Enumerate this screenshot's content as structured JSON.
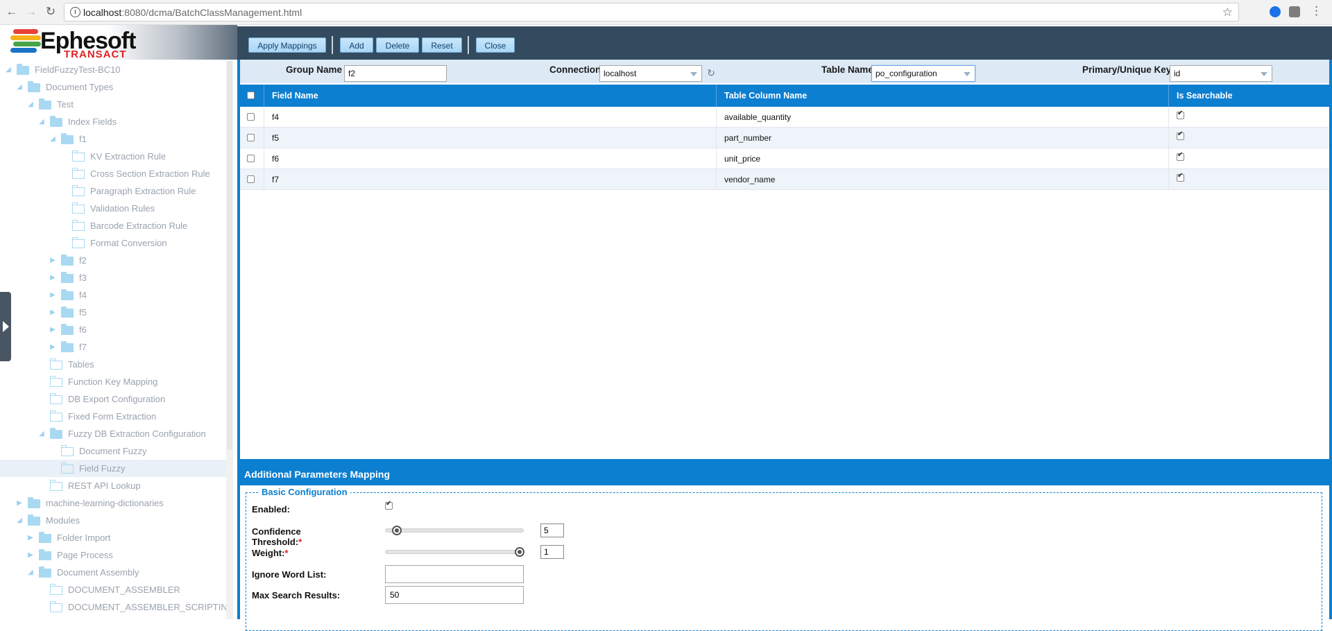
{
  "browser": {
    "url_host": "localhost",
    "url_path": ":8080/dcma/BatchClassManagement.html",
    "back_icon": "arrow-left",
    "forward_icon": "arrow-right",
    "reload_icon": "reload",
    "info_icon": "i",
    "star_icon": "☆",
    "menu_icon": "⋮"
  },
  "logo": {
    "word": "Ephesoft",
    "sub": "TRANSACT",
    "stripe_colors": [
      "#e94235",
      "#f6b21b",
      "#46a548",
      "#1a73c6"
    ]
  },
  "tree": [
    {
      "label": "FieldFuzzyTest-BC10",
      "state": "open"
    },
    {
      "label": "Document Types",
      "state": "open"
    },
    {
      "label": "Test",
      "state": "open"
    },
    {
      "label": "Index Fields",
      "state": "open"
    },
    {
      "label": "f1",
      "state": "open"
    },
    {
      "label": "KV Extraction Rule",
      "state": "empty"
    },
    {
      "label": "Cross Section Extraction Rule",
      "state": "empty"
    },
    {
      "label": "Paragraph Extraction Rule",
      "state": "empty"
    },
    {
      "label": "Validation Rules",
      "state": "empty"
    },
    {
      "label": "Barcode Extraction Rule",
      "state": "empty"
    },
    {
      "label": "Format Conversion",
      "state": "empty"
    },
    {
      "label": "f2",
      "state": "closed"
    },
    {
      "label": "f3",
      "state": "closed"
    },
    {
      "label": "f4",
      "state": "closed"
    },
    {
      "label": "f5",
      "state": "closed"
    },
    {
      "label": "f6",
      "state": "closed"
    },
    {
      "label": "f7",
      "state": "closed"
    },
    {
      "label": "Tables",
      "state": "empty"
    },
    {
      "label": "Function Key Mapping",
      "state": "empty"
    },
    {
      "label": "DB Export Configuration",
      "state": "empty"
    },
    {
      "label": "Fixed Form Extraction",
      "state": "empty"
    },
    {
      "label": "Fuzzy DB Extraction Configuration",
      "state": "open"
    },
    {
      "label": "Document Fuzzy",
      "state": "empty"
    },
    {
      "label": "Field Fuzzy",
      "state": "empty",
      "selected": true
    },
    {
      "label": "REST API Lookup",
      "state": "empty"
    },
    {
      "label": "machine-learning-dictionaries",
      "state": "closed"
    },
    {
      "label": "Modules",
      "state": "open"
    },
    {
      "label": "Folder Import",
      "state": "closed"
    },
    {
      "label": "Page Process",
      "state": "closed"
    },
    {
      "label": "Document Assembly",
      "state": "open"
    },
    {
      "label": "DOCUMENT_ASSEMBLER",
      "state": "empty"
    },
    {
      "label": "DOCUMENT_ASSEMBLER_SCRIPTIN",
      "state": "empty"
    }
  ],
  "toolbar": {
    "apply_mappings": "Apply Mappings",
    "add": "Add",
    "delete": "Delete",
    "reset": "Reset",
    "close": "Close"
  },
  "filters": {
    "group_name_label": "Group Name",
    "group_name_value": "f2",
    "connection_label": "Connection",
    "connection_value": "localhost",
    "table_name_label": "Table Name",
    "table_name_value": "po_configuration",
    "key_label": "Primary/Unique Key",
    "key_value": "id"
  },
  "grid": {
    "headers": [
      "Field Name",
      "Table Column Name",
      "Is Searchable"
    ],
    "rows": [
      {
        "field": "f4",
        "column": "available_quantity",
        "searchable": true
      },
      {
        "field": "f5",
        "column": "part_number",
        "searchable": true
      },
      {
        "field": "f6",
        "column": "unit_price",
        "searchable": true
      },
      {
        "field": "f7",
        "column": "vendor_name",
        "searchable": true
      }
    ]
  },
  "params": {
    "title": "Additional Parameters Mapping",
    "legend": "Basic Configuration",
    "enabled_label": "Enabled:",
    "enabled": true,
    "confidence_label_1": "Confidence",
    "confidence_label_2": "Threshold:",
    "confidence_value": "5",
    "confidence_level": 0.05,
    "weight_label": "Weight:",
    "weight_value": "1",
    "weight_level": 1.0,
    "ignore_label": "Ignore Word List:",
    "ignore_value": "",
    "max_label": "Max Search Results:",
    "max_value": "50",
    "required_mark": "*"
  }
}
